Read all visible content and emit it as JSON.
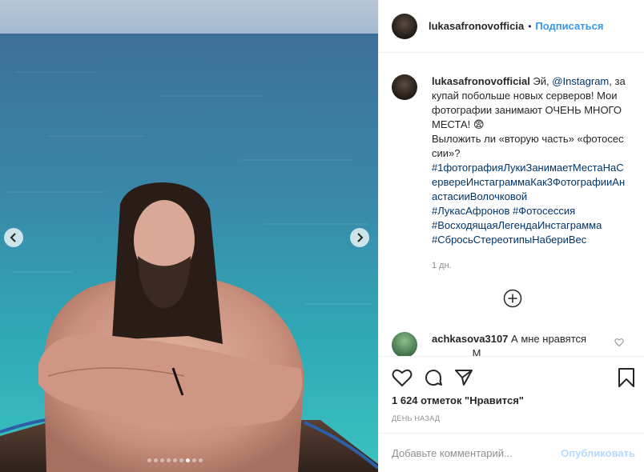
{
  "post": {
    "dots_total": 9,
    "dots_active_index": 6
  },
  "header": {
    "username": "lukasafronovofficia",
    "separator": "•",
    "follow_label": "Подписаться"
  },
  "caption": {
    "username": "lukasafronovofficial",
    "text_part1": " Эй, ",
    "mention": "@Instagram",
    "text_part2": ", закупай побольше новых серверов! Мои фотографии занимают ОЧЕНЬ МНОГО МЕСТА! 😨",
    "text_part3": "Выложить ли «вторую часть» «фотосессии»?",
    "hashtags": [
      "#1фотографияЛукиЗанимаетМестаНаСервереИнстаграммаКак3ФотографииАнастасииВолочковой",
      "#ЛукасАфронов",
      "#Фотосессия",
      "#ВосходящаяЛегендаИнстаграмма",
      "#СбросьСтереотипыНабериВес"
    ],
    "time": "1 дн."
  },
  "comment": {
    "username": "achkasova3107",
    "text": " А мне нравятся",
    "text_cut": "              М"
  },
  "actions": {
    "likes": "1 624 отметок \"Нравится\"",
    "ago": "ДЕНЬ НАЗАД"
  },
  "add_comment": {
    "placeholder": "Добавьте комментарий...",
    "publish_label": "Опубликовать"
  }
}
